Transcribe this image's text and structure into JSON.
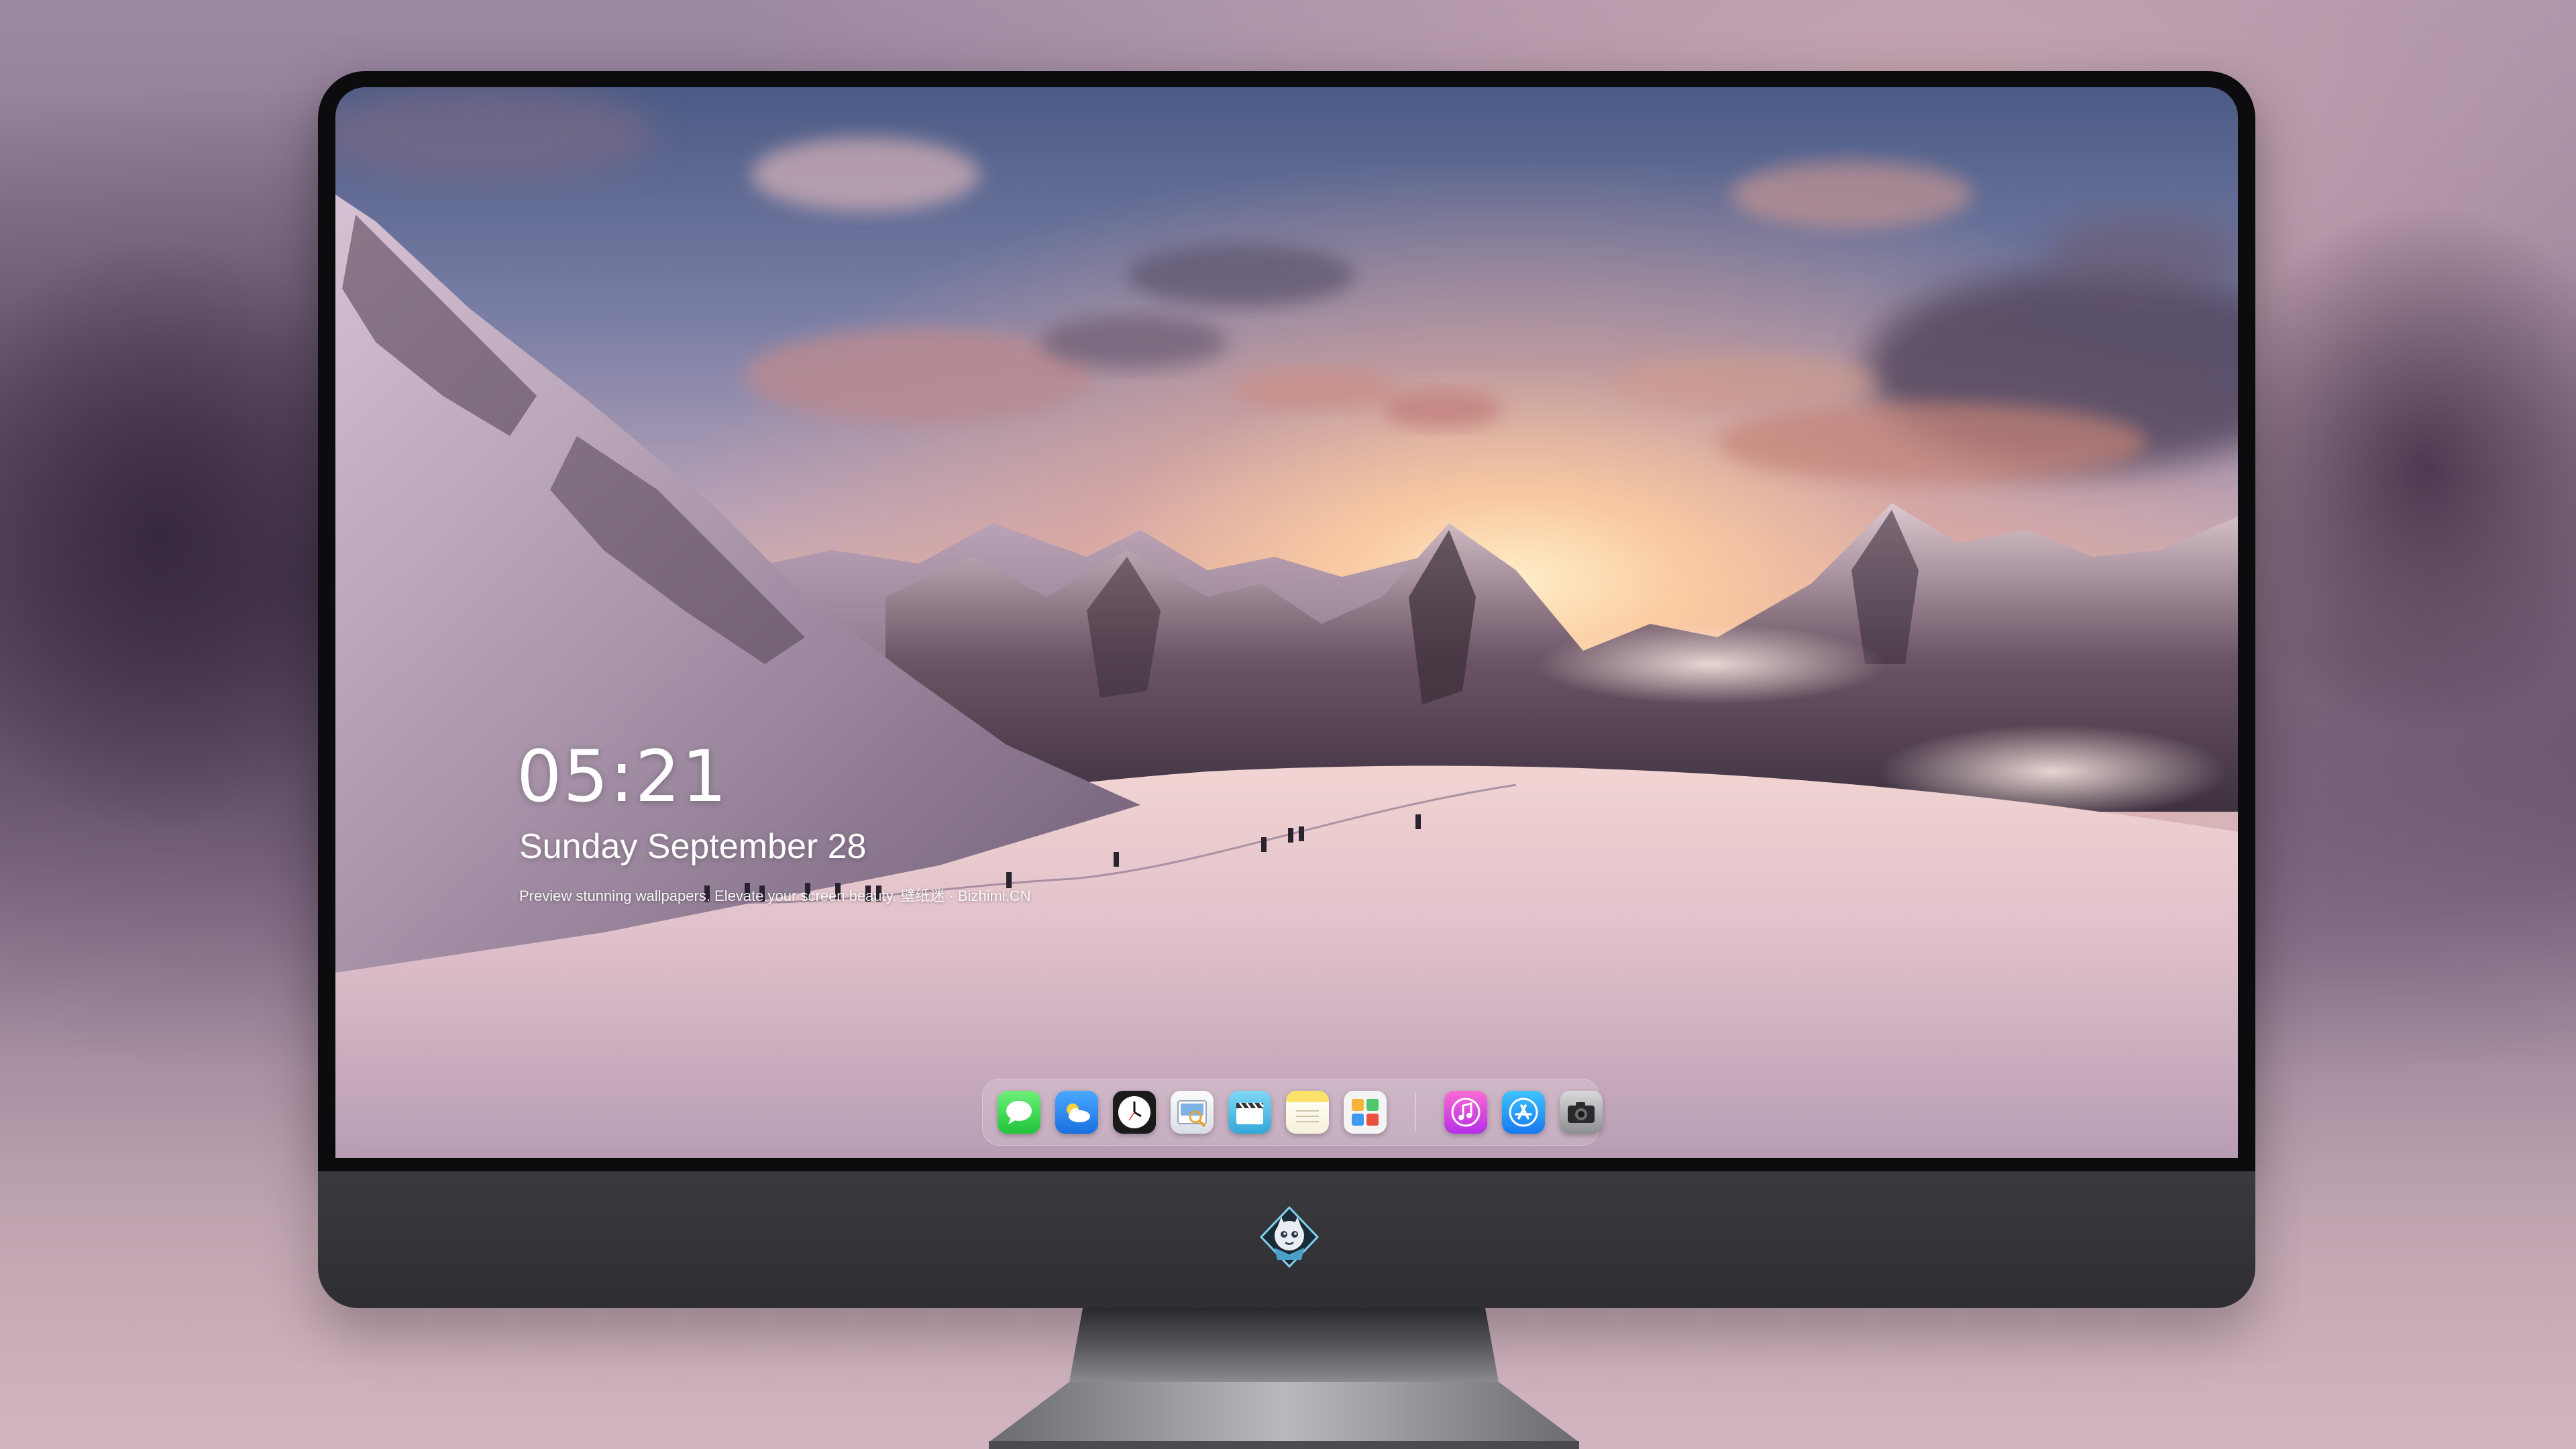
{
  "lockscreen": {
    "time": "05:21",
    "date": "Sunday September 28",
    "tagline": "Preview stunning wallpapers. Elevate your screen beauty. 壁纸迷 · Bizhimi.CN"
  },
  "dock": {
    "apps": [
      {
        "name": "Messages",
        "icon": "messages-icon"
      },
      {
        "name": "Weather",
        "icon": "weather-icon"
      },
      {
        "name": "Clock",
        "icon": "clock-icon"
      },
      {
        "name": "Preview",
        "icon": "preview-icon"
      },
      {
        "name": "Video",
        "icon": "clapperboard-icon"
      },
      {
        "name": "Notes",
        "icon": "notes-icon"
      },
      {
        "name": "Photos",
        "icon": "photos-icon"
      },
      {
        "name": "Music",
        "icon": "music-icon"
      },
      {
        "name": "App Store",
        "icon": "app-store-icon"
      },
      {
        "name": "Camera",
        "icon": "camera-icon"
      }
    ]
  },
  "monitor": {
    "logo": "dragon-mascot-logo"
  },
  "colors": {
    "bezel": "#0c0b0e",
    "chin": "#333338",
    "text": "#ffffff"
  }
}
